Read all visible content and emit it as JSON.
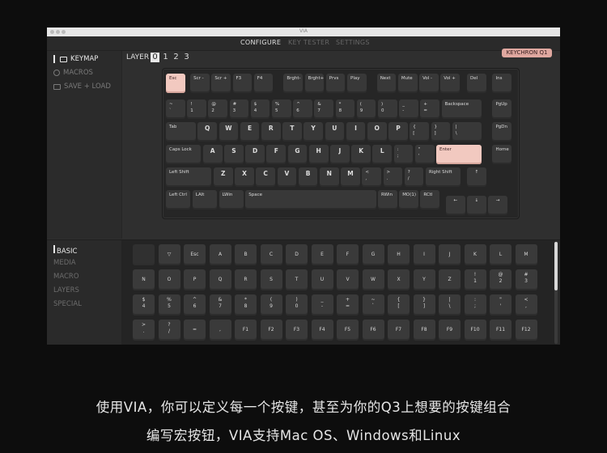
{
  "window": {
    "title": "VIA"
  },
  "nav": {
    "tabs": [
      {
        "label": "CONFIGURE",
        "active": true
      },
      {
        "label": "KEY TESTER",
        "active": false
      },
      {
        "label": "SETTINGS",
        "active": false
      }
    ]
  },
  "sidebar": {
    "items": [
      {
        "label": "KEYMAP",
        "icon": "keyboard-icon",
        "active": true
      },
      {
        "label": "MACROS",
        "icon": "record-icon",
        "active": false
      },
      {
        "label": "SAVE + LOAD",
        "icon": "save-icon",
        "active": false
      }
    ]
  },
  "layer": {
    "label": "LAYER",
    "numbers": [
      "0",
      "1",
      "2",
      "3"
    ],
    "active": "0"
  },
  "keyboard_name": "KEYCHRON Q1",
  "keys": {
    "row0": [
      "Esc",
      "Scr -",
      "Scr +",
      "F3",
      "F4",
      "Brght-",
      "Brght+",
      "Prvs",
      "Play",
      "Next",
      "Mute",
      "Vol -",
      "Vol +",
      "Del",
      "Ins"
    ],
    "row1": [
      "~\n`",
      "!\n1",
      "@\n2",
      "#\n3",
      "$\n4",
      "%\n5",
      "^\n6",
      "&\n7",
      "*\n8",
      "(\n9",
      ")\n0",
      "_\n-",
      "+\n=",
      "Backspace",
      "PgUp"
    ],
    "row2": [
      "Tab",
      "Q",
      "W",
      "E",
      "R",
      "T",
      "Y",
      "U",
      "I",
      "O",
      "P",
      "{\n[",
      "}\n]",
      "|\n\\",
      "PgDn"
    ],
    "row3": [
      "Caps Lock",
      "A",
      "S",
      "D",
      "F",
      "G",
      "H",
      "J",
      "K",
      "L",
      ":\n;",
      "\"\n'",
      "Enter",
      "Home"
    ],
    "row4": [
      "Left Shift",
      "Z",
      "X",
      "C",
      "V",
      "B",
      "N",
      "M",
      "<\n,",
      ">\n.",
      "?\n/",
      "Right Shift",
      "↑"
    ],
    "row5": [
      "Left Ctrl",
      "LAlt",
      "LWin",
      "Space",
      "RWin",
      "MO(1)",
      "RCtl",
      "←",
      "↓",
      "→"
    ]
  },
  "categories": [
    {
      "label": "BASIC",
      "active": true
    },
    {
      "label": "MEDIA",
      "active": false
    },
    {
      "label": "MACRO",
      "active": false
    },
    {
      "label": "LAYERS",
      "active": false
    },
    {
      "label": "SPECIAL",
      "active": false
    }
  ],
  "basic_keys": [
    [
      "",
      "▽",
      "Esc",
      "A",
      "B",
      "C",
      "D",
      "E",
      "F",
      "G",
      "H",
      "I",
      "J",
      "K",
      "L",
      "M"
    ],
    [
      "N",
      "O",
      "P",
      "Q",
      "R",
      "S",
      "T",
      "U",
      "V",
      "W",
      "X",
      "Y",
      "Z",
      "!\n1",
      "@\n2",
      "#\n3"
    ],
    [
      "$\n4",
      "%\n5",
      "^\n6",
      "&\n7",
      "*\n8",
      "(\n9",
      ")\n0",
      "_\n-",
      "+\n=",
      "~\n`",
      "{\n[",
      "}\n]",
      "|\n\\",
      ":\n;",
      "\"\n'",
      "<\n,"
    ],
    [
      ">\n.",
      "?\n/",
      "=",
      ",",
      "F1",
      "F2",
      "F3",
      "F4",
      "F5",
      "F6",
      "F7",
      "F8",
      "F9",
      "F10",
      "F11",
      "F12"
    ]
  ],
  "caption": {
    "line1": "使用VIA，你可以定义每一个按键，甚至为你的Q3上想要的按键组合",
    "line2": "编写宏按钮，VIA支持Mac OS、Windows和Linux"
  },
  "colors": {
    "accent": "#f2c9c0",
    "badge": "#e0a8a0"
  }
}
